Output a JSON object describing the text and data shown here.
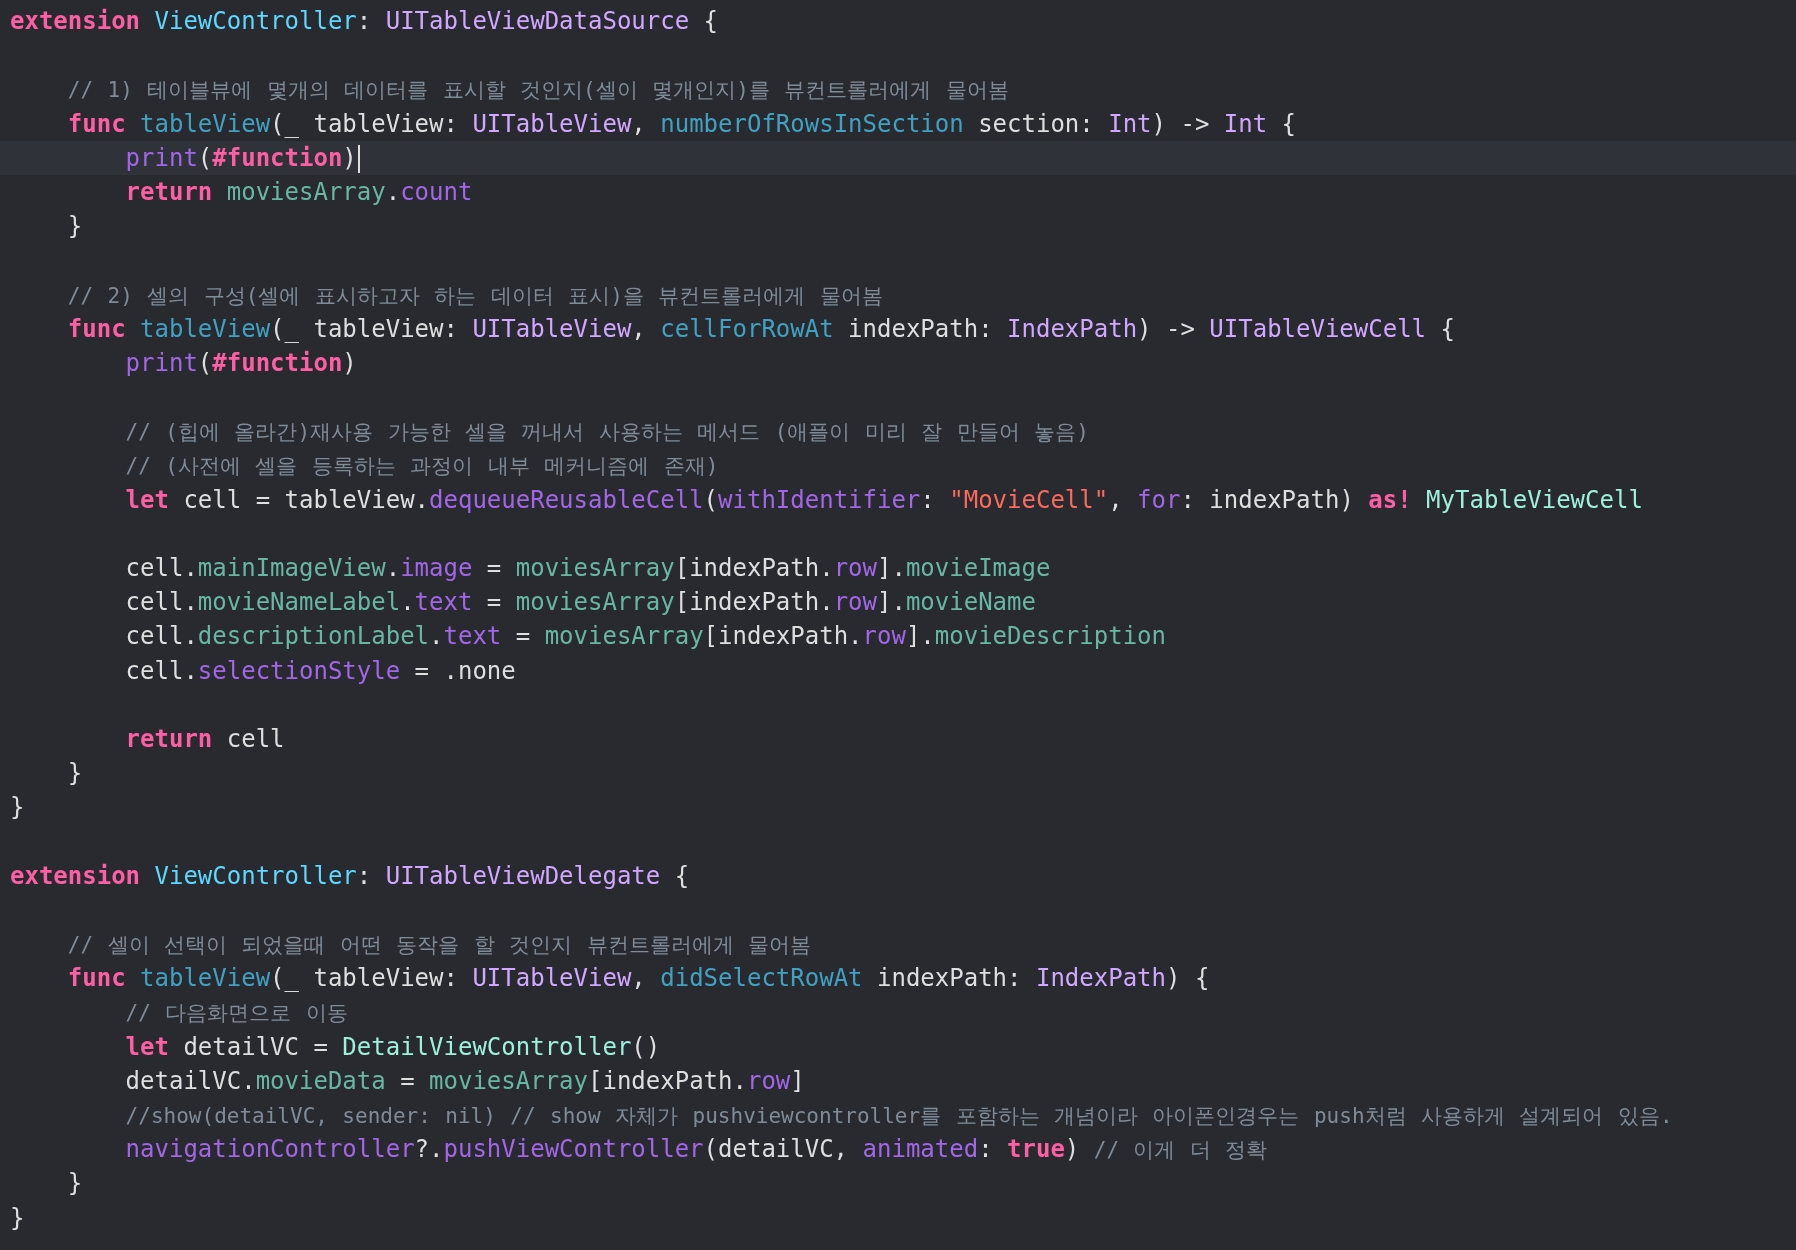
{
  "editor": {
    "lines": [
      {
        "kind": "code",
        "current": false,
        "tokens": [
          {
            "text": "extension ",
            "kind": "kw"
          },
          {
            "text": "ViewController",
            "kind": "typedecl"
          },
          {
            "text": ": ",
            "kind": "plain"
          },
          {
            "text": "UITableViewDataSource",
            "kind": "type"
          },
          {
            "text": " {",
            "kind": "plain"
          }
        ]
      },
      {
        "kind": "blank"
      },
      {
        "kind": "code",
        "current": false,
        "tokens": [
          {
            "text": "    // 1) 테이블뷰에 몇개의 데이터를 표시할 것인지(셀이 몇개인지)를 뷰컨트롤러에게 물어봄",
            "kind": "cmt"
          }
        ]
      },
      {
        "kind": "code",
        "current": false,
        "tokens": [
          {
            "text": "    func ",
            "kind": "kw"
          },
          {
            "text": "tableView",
            "kind": "decl"
          },
          {
            "text": "(_ tableView: ",
            "kind": "plain"
          },
          {
            "text": "UITableView",
            "kind": "type"
          },
          {
            "text": ", ",
            "kind": "plain"
          },
          {
            "text": "numberOfRowsInSection",
            "kind": "decl"
          },
          {
            "text": " section: ",
            "kind": "plain"
          },
          {
            "text": "Int",
            "kind": "type"
          },
          {
            "text": ") -> ",
            "kind": "plain"
          },
          {
            "text": "Int",
            "kind": "type"
          },
          {
            "text": " {",
            "kind": "plain"
          }
        ]
      },
      {
        "kind": "code",
        "current": true,
        "tokens": [
          {
            "text": "        print",
            "kind": "other"
          },
          {
            "text": "(",
            "kind": "plain"
          },
          {
            "text": "#function",
            "kind": "kw"
          },
          {
            "text": ")",
            "kind": "plain"
          }
        ]
      },
      {
        "kind": "code",
        "current": false,
        "tokens": [
          {
            "text": "        return ",
            "kind": "kw"
          },
          {
            "text": "moviesArray",
            "kind": "pvar"
          },
          {
            "text": ".",
            "kind": "plain"
          },
          {
            "text": "count",
            "kind": "other"
          }
        ]
      },
      {
        "kind": "code",
        "current": false,
        "tokens": [
          {
            "text": "    }",
            "kind": "plain"
          }
        ]
      },
      {
        "kind": "blank"
      },
      {
        "kind": "code",
        "current": false,
        "tokens": [
          {
            "text": "    // 2) 셀의 구성(셀에 표시하고자 하는 데이터 표시)을 뷰컨트롤러에게 물어봄",
            "kind": "cmt"
          }
        ]
      },
      {
        "kind": "code",
        "current": false,
        "tokens": [
          {
            "text": "    func ",
            "kind": "kw"
          },
          {
            "text": "tableView",
            "kind": "decl"
          },
          {
            "text": "(_ tableView: ",
            "kind": "plain"
          },
          {
            "text": "UITableView",
            "kind": "type"
          },
          {
            "text": ", ",
            "kind": "plain"
          },
          {
            "text": "cellForRowAt",
            "kind": "decl"
          },
          {
            "text": " indexPath: ",
            "kind": "plain"
          },
          {
            "text": "IndexPath",
            "kind": "type"
          },
          {
            "text": ") -> ",
            "kind": "plain"
          },
          {
            "text": "UITableViewCell",
            "kind": "type"
          },
          {
            "text": " {",
            "kind": "plain"
          }
        ]
      },
      {
        "kind": "code",
        "current": false,
        "tokens": [
          {
            "text": "        print",
            "kind": "other"
          },
          {
            "text": "(",
            "kind": "plain"
          },
          {
            "text": "#function",
            "kind": "kw"
          },
          {
            "text": ")",
            "kind": "plain"
          }
        ]
      },
      {
        "kind": "blank"
      },
      {
        "kind": "code",
        "current": false,
        "tokens": [
          {
            "text": "        // (힙에 올라간)재사용 가능한 셀을 꺼내서 사용하는 메서드 (애플이 미리 잘 만들어 놓음)",
            "kind": "cmt"
          }
        ]
      },
      {
        "kind": "code",
        "current": false,
        "tokens": [
          {
            "text": "        // (사전에 셀을 등록하는 과정이 내부 메커니즘에 존재)",
            "kind": "cmt"
          }
        ]
      },
      {
        "kind": "code",
        "current": false,
        "tokens": [
          {
            "text": "        let ",
            "kind": "kw"
          },
          {
            "text": "cell = tableView.",
            "kind": "plain"
          },
          {
            "text": "dequeueReusableCell",
            "kind": "other"
          },
          {
            "text": "(",
            "kind": "plain"
          },
          {
            "text": "withIdentifier",
            "kind": "other"
          },
          {
            "text": ": ",
            "kind": "plain"
          },
          {
            "text": "\"MovieCell\"",
            "kind": "str"
          },
          {
            "text": ", ",
            "kind": "plain"
          },
          {
            "text": "for",
            "kind": "other"
          },
          {
            "text": ": indexPath) ",
            "kind": "plain"
          },
          {
            "text": "as! ",
            "kind": "kw"
          },
          {
            "text": "MyTableViewCell",
            "kind": "ptype"
          }
        ]
      },
      {
        "kind": "blank"
      },
      {
        "kind": "code",
        "current": false,
        "tokens": [
          {
            "text": "        cell.",
            "kind": "plain"
          },
          {
            "text": "mainImageView",
            "kind": "pvar"
          },
          {
            "text": ".",
            "kind": "plain"
          },
          {
            "text": "image",
            "kind": "other"
          },
          {
            "text": " = ",
            "kind": "plain"
          },
          {
            "text": "moviesArray",
            "kind": "pvar"
          },
          {
            "text": "[indexPath.",
            "kind": "plain"
          },
          {
            "text": "row",
            "kind": "other"
          },
          {
            "text": "].",
            "kind": "plain"
          },
          {
            "text": "movieImage",
            "kind": "pvar"
          }
        ]
      },
      {
        "kind": "code",
        "current": false,
        "tokens": [
          {
            "text": "        cell.",
            "kind": "plain"
          },
          {
            "text": "movieNameLabel",
            "kind": "pvar"
          },
          {
            "text": ".",
            "kind": "plain"
          },
          {
            "text": "text",
            "kind": "other"
          },
          {
            "text": " = ",
            "kind": "plain"
          },
          {
            "text": "moviesArray",
            "kind": "pvar"
          },
          {
            "text": "[indexPath.",
            "kind": "plain"
          },
          {
            "text": "row",
            "kind": "other"
          },
          {
            "text": "].",
            "kind": "plain"
          },
          {
            "text": "movieName",
            "kind": "pvar"
          }
        ]
      },
      {
        "kind": "code",
        "current": false,
        "tokens": [
          {
            "text": "        cell.",
            "kind": "plain"
          },
          {
            "text": "descriptionLabel",
            "kind": "pvar"
          },
          {
            "text": ".",
            "kind": "plain"
          },
          {
            "text": "text",
            "kind": "other"
          },
          {
            "text": " = ",
            "kind": "plain"
          },
          {
            "text": "moviesArray",
            "kind": "pvar"
          },
          {
            "text": "[indexPath.",
            "kind": "plain"
          },
          {
            "text": "row",
            "kind": "other"
          },
          {
            "text": "].",
            "kind": "plain"
          },
          {
            "text": "movieDescription",
            "kind": "pvar"
          }
        ]
      },
      {
        "kind": "code",
        "current": false,
        "tokens": [
          {
            "text": "        cell.",
            "kind": "plain"
          },
          {
            "text": "selectionStyle",
            "kind": "other"
          },
          {
            "text": " = .none",
            "kind": "plain"
          }
        ]
      },
      {
        "kind": "blank"
      },
      {
        "kind": "code",
        "current": false,
        "tokens": [
          {
            "text": "        return ",
            "kind": "kw"
          },
          {
            "text": "cell",
            "kind": "plain"
          }
        ]
      },
      {
        "kind": "code",
        "current": false,
        "tokens": [
          {
            "text": "    }",
            "kind": "plain"
          }
        ]
      },
      {
        "kind": "code",
        "current": false,
        "tokens": [
          {
            "text": "}",
            "kind": "plain"
          }
        ]
      },
      {
        "kind": "blank"
      },
      {
        "kind": "code",
        "current": false,
        "tokens": [
          {
            "text": "extension ",
            "kind": "kw"
          },
          {
            "text": "ViewController",
            "kind": "typedecl"
          },
          {
            "text": ": ",
            "kind": "plain"
          },
          {
            "text": "UITableViewDelegate",
            "kind": "type"
          },
          {
            "text": " {",
            "kind": "plain"
          }
        ]
      },
      {
        "kind": "blank"
      },
      {
        "kind": "code",
        "current": false,
        "tokens": [
          {
            "text": "    // 셀이 선택이 되었을때 어떤 동작을 할 것인지 뷰컨트롤러에게 물어봄",
            "kind": "cmt"
          }
        ]
      },
      {
        "kind": "code",
        "current": false,
        "tokens": [
          {
            "text": "    func ",
            "kind": "kw"
          },
          {
            "text": "tableView",
            "kind": "decl"
          },
          {
            "text": "(_ tableView: ",
            "kind": "plain"
          },
          {
            "text": "UITableView",
            "kind": "type"
          },
          {
            "text": ", ",
            "kind": "plain"
          },
          {
            "text": "didSelectRowAt",
            "kind": "decl"
          },
          {
            "text": " indexPath: ",
            "kind": "plain"
          },
          {
            "text": "IndexPath",
            "kind": "type"
          },
          {
            "text": ") {",
            "kind": "plain"
          }
        ]
      },
      {
        "kind": "code",
        "current": false,
        "tokens": [
          {
            "text": "        // 다음화면으로 이동",
            "kind": "cmt"
          }
        ]
      },
      {
        "kind": "code",
        "current": false,
        "tokens": [
          {
            "text": "        let ",
            "kind": "kw"
          },
          {
            "text": "detailVC = ",
            "kind": "plain"
          },
          {
            "text": "DetailViewController",
            "kind": "ptype"
          },
          {
            "text": "()",
            "kind": "plain"
          }
        ]
      },
      {
        "kind": "code",
        "current": false,
        "tokens": [
          {
            "text": "        detailVC.",
            "kind": "plain"
          },
          {
            "text": "movieData",
            "kind": "pvar"
          },
          {
            "text": " = ",
            "kind": "plain"
          },
          {
            "text": "moviesArray",
            "kind": "pvar"
          },
          {
            "text": "[indexPath.",
            "kind": "plain"
          },
          {
            "text": "row",
            "kind": "other"
          },
          {
            "text": "]",
            "kind": "plain"
          }
        ]
      },
      {
        "kind": "code",
        "current": false,
        "tokens": [
          {
            "text": "        //show(detailVC, sender: nil) // show 자체가 pushviewcontroller를 포함하는 개념이라 아이폰인경우는 push처럼 사용하게 설계되어 있음.",
            "kind": "cmt"
          }
        ]
      },
      {
        "kind": "code",
        "current": false,
        "tokens": [
          {
            "text": "        navigationController",
            "kind": "other"
          },
          {
            "text": "?.",
            "kind": "plain"
          },
          {
            "text": "pushViewController",
            "kind": "other"
          },
          {
            "text": "(detailVC, ",
            "kind": "plain"
          },
          {
            "text": "animated",
            "kind": "other"
          },
          {
            "text": ": ",
            "kind": "plain"
          },
          {
            "text": "true",
            "kind": "kw"
          },
          {
            "text": ") ",
            "kind": "plain"
          },
          {
            "text": "// 이게 더 정확",
            "kind": "cmt"
          }
        ]
      },
      {
        "kind": "code",
        "current": false,
        "tokens": [
          {
            "text": "    }",
            "kind": "plain"
          }
        ]
      },
      {
        "kind": "code",
        "current": false,
        "tokens": [
          {
            "text": "}",
            "kind": "plain"
          }
        ]
      }
    ]
  }
}
